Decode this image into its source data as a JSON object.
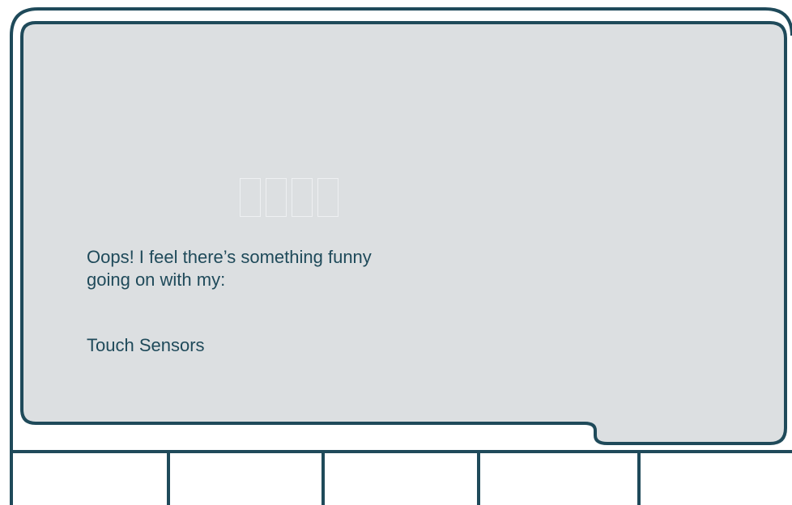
{
  "display": {
    "error_line_1": "Oops! I feel there’s something funny",
    "error_line_2": "going on with my:",
    "sensor": "Touch Sensors"
  },
  "softkeys": [
    {
      "label": ""
    },
    {
      "label": ""
    },
    {
      "label": ""
    },
    {
      "label": ""
    },
    {
      "label": ""
    }
  ],
  "colors": {
    "outline": "#1f4a5a",
    "screen_fill": "#dcdfe1",
    "background": "#ffffff",
    "text": "#1f4a5a"
  }
}
